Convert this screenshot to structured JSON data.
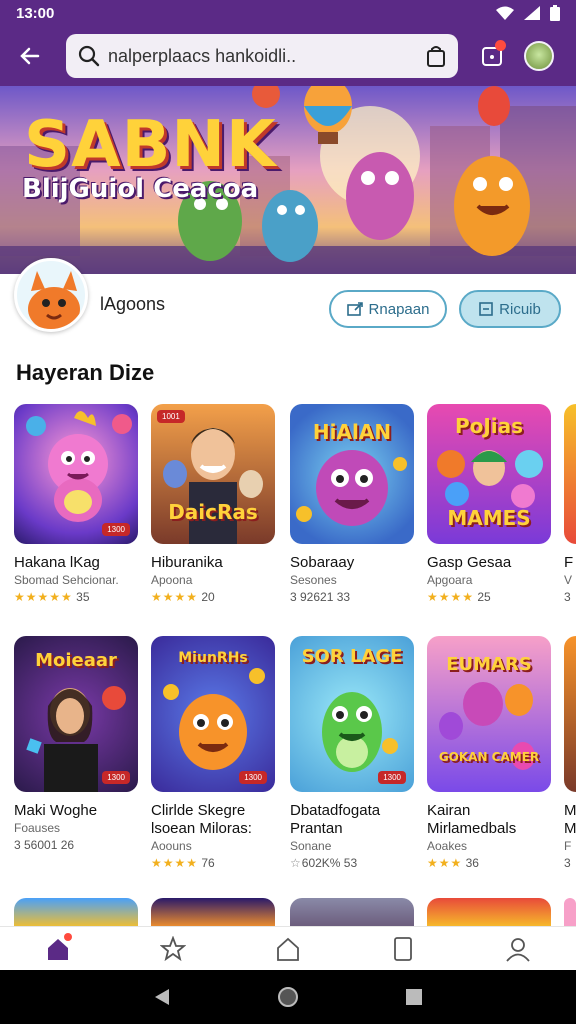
{
  "status": {
    "time": "13:00"
  },
  "search": {
    "text": "nalperplaacs hankoidli.."
  },
  "banner": {
    "title": "SABNK",
    "subtitle": "BlijGuiol Ceacoa"
  },
  "profile": {
    "name": "lAgoons",
    "btn_outline_label": "Rnapaan",
    "btn_filled_label": "Ricuib"
  },
  "section": {
    "title": "Hayeran Dize"
  },
  "games_row1": [
    {
      "title": "Hakana lKag",
      "sub": "Sbomad Sehcionar.",
      "stars": "★★★★★",
      "rating": "35"
    },
    {
      "title": "Hiburanika",
      "sub": "Apoona",
      "stars": "★★★★",
      "rating": "20"
    },
    {
      "title": "Sobaraay",
      "sub": "Sesones",
      "stars": "",
      "rating": "3 92621 33"
    },
    {
      "title": "Gasp Gesaa",
      "sub": "Apgoara",
      "stars": "★★★★",
      "rating": "25"
    },
    {
      "title": "F",
      "sub": "V",
      "stars": "",
      "rating": "3"
    }
  ],
  "games_row2": [
    {
      "title": "Maki Woghe",
      "title2": "",
      "sub": "Foauses",
      "stars": "",
      "rating": "3 56001 26"
    },
    {
      "title": "Clirlde Skegre",
      "title2": "lsoean Miloras:",
      "sub": "Aoouns",
      "stars": "★★★★",
      "rating": "76"
    },
    {
      "title": "Dbatadfogata",
      "title2": "Prantan",
      "sub": "Sonane",
      "stars": "☆",
      "rating": "602K% 53"
    },
    {
      "title": "Kairan",
      "title2": "Mirlamedbals",
      "sub": "Aoakes",
      "stars": "★★★",
      "rating": "36"
    },
    {
      "title": "M",
      "title2": "M",
      "sub": "F",
      "stars": "",
      "rating": "3"
    }
  ],
  "thumbs": {
    "r1c1": "",
    "r1c2": "DaicRas",
    "r1c3": "HiAlAN",
    "r1c4": "PoJias",
    "r1c4b": "MAMES",
    "r2c1": "Moieaar",
    "r2c2": "MiunRHs",
    "r2c3": "SOR LAGE",
    "r2c4": "EUMARS",
    "r2c4b": "GOKAN CAMER",
    "badge": "1300",
    "badge_tl": "1001"
  },
  "colors": {
    "header": "#5b2a86",
    "accent_blue": "#5aa9c7",
    "star": "#f2b01e"
  },
  "nav": {
    "icons": [
      "home-icon",
      "star-icon",
      "house-outline-icon",
      "tablet-icon",
      "profile-icon"
    ]
  }
}
